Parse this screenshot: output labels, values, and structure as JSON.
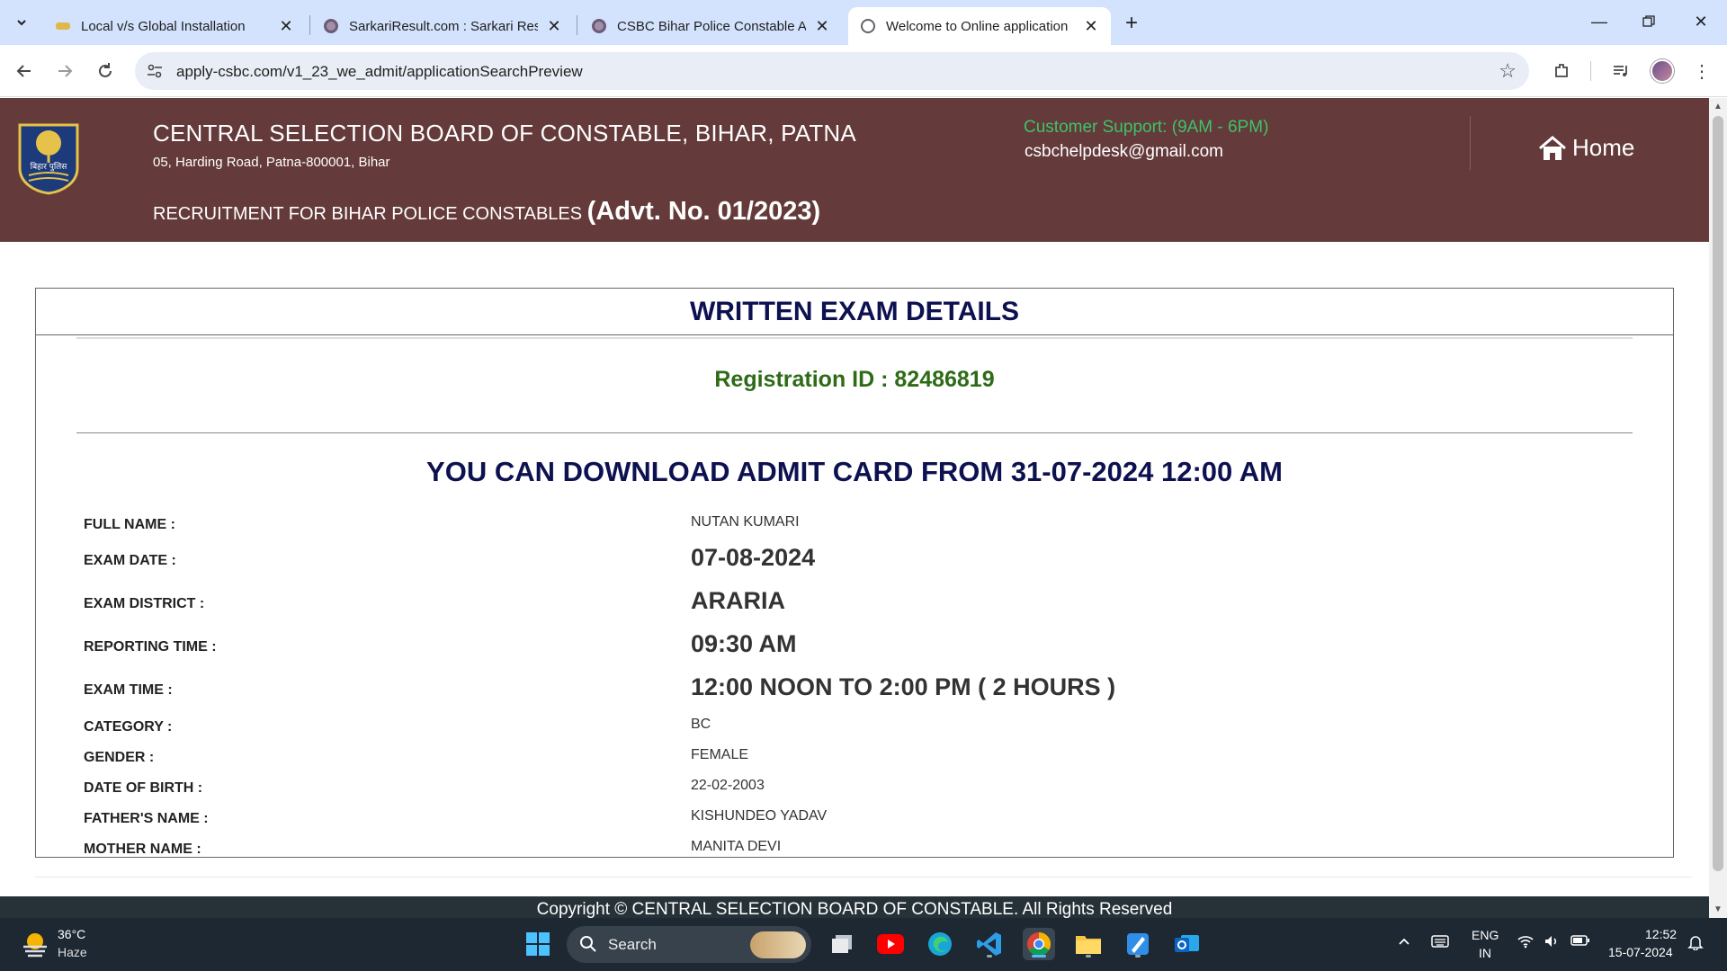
{
  "browser": {
    "tabs": [
      {
        "title": "Local v/s Global Installation",
        "active": false
      },
      {
        "title": "SarkariResult.com : Sarkari Resu",
        "active": false
      },
      {
        "title": "CSBC Bihar Police Constable Ad",
        "active": false
      },
      {
        "title": "Welcome to Online application",
        "active": true
      }
    ],
    "url": "apply-csbc.com/v1_23_we_admit/applicationSearchPreview"
  },
  "header": {
    "title": "CENTRAL SELECTION BOARD OF CONSTABLE, BIHAR, PATNA",
    "address": "05, Harding Road, Patna-800001, Bihar",
    "recruitment_prefix": "RECRUITMENT FOR BIHAR POLICE CONSTABLES",
    "advt": "(Advt. No. 01/2023)",
    "support_label": "Customer Support: (9AM - 6PM)",
    "support_email": "csbchelpdesk@gmail.com",
    "home_label": "Home",
    "emblem_text": "बिहार पुलिस"
  },
  "details": {
    "title": "WRITTEN EXAM DETAILS",
    "registration": "Registration ID : 82486819",
    "download_note": "YOU CAN DOWNLOAD ADMIT CARD FROM 31-07-2024 12:00 AM",
    "rows": [
      {
        "label": "FULL NAME :",
        "value": "NUTAN KUMARI"
      },
      {
        "label": "EXAM DATE :",
        "value": "07-08-2024"
      },
      {
        "label": "EXAM DISTRICT :",
        "value": "ARARIA"
      },
      {
        "label": "REPORTING TIME :",
        "value": "09:30 AM"
      },
      {
        "label": "EXAM TIME :",
        "value": "12:00 NOON TO 2:00 PM ( 2 HOURS )"
      },
      {
        "label": "CATEGORY :",
        "value": "BC"
      },
      {
        "label": "GENDER :",
        "value": "FEMALE"
      },
      {
        "label": "DATE OF BIRTH :",
        "value": "22-02-2003"
      },
      {
        "label": "FATHER'S NAME :",
        "value": "KISHUNDEO YADAV"
      },
      {
        "label": "MOTHER NAME :",
        "value": "MANITA DEVI"
      }
    ]
  },
  "footer": {
    "copyright": "Copyright © CENTRAL SELECTION BOARD OF CONSTABLE. All Rights Reserved"
  },
  "taskbar": {
    "temperature": "36°C",
    "weather": "Haze",
    "search_label": "Search",
    "lang_1": "ENG",
    "lang_2": "IN",
    "time": "12:52",
    "date": "15-07-2024"
  },
  "colors": {
    "header_bg": "#643a3a",
    "support_green": "#3ec36a",
    "title_navy": "#0d1150",
    "registration_green": "#2e6b16",
    "footer_bg": "#263238"
  }
}
